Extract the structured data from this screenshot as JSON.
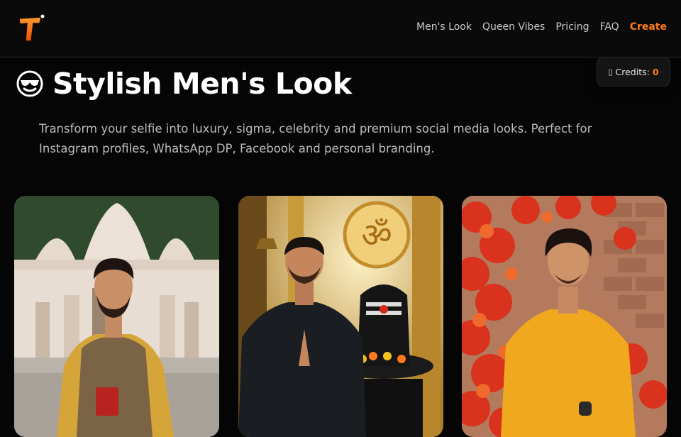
{
  "nav": {
    "logo_letter": "T",
    "links": [
      "Men's Look",
      "Queen Vibes",
      "Pricing",
      "FAQ"
    ],
    "create_label": "Create"
  },
  "credits": {
    "label": "Credits:",
    "value": "0",
    "icon": "coin-icon"
  },
  "page": {
    "title": "Stylish Men's Look",
    "title_icon": "smiling-face-with-sunglasses-icon",
    "description": "Transform your selfie into luxury, sigma, celebrity and premium social media looks. Perfect for Instagram profiles, WhatsApp DP, Facebook and personal branding."
  },
  "gallery": {
    "cards": [
      {
        "subject": "man-in-brown-nehru-jacket-temple"
      },
      {
        "subject": "man-praying-shivling-om"
      },
      {
        "subject": "man-yellow-kurta-red-leaves"
      }
    ]
  },
  "colors": {
    "accent": "#ff7a1a",
    "background": "#050505"
  }
}
